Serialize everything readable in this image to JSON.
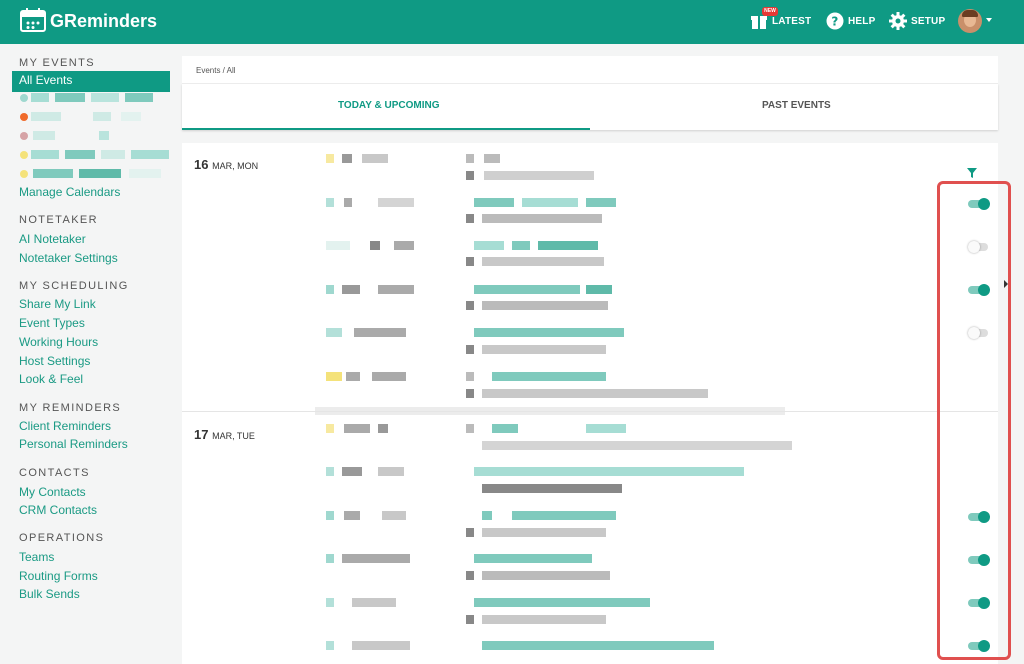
{
  "header": {
    "brand": "GReminders",
    "latest_label": "LATEST",
    "new_badge": "NEW",
    "help_label": "HELP",
    "setup_label": "SETUP"
  },
  "sidebar": {
    "my_events": {
      "title": "MY EVENTS",
      "active": "All Events",
      "manage": "Manage Calendars"
    },
    "notetaker": {
      "title": "NOTETAKER",
      "items": [
        "AI Notetaker",
        "Notetaker Settings"
      ]
    },
    "my_scheduling": {
      "title": "MY SCHEDULING",
      "items": [
        "Share My Link",
        "Event Types",
        "Working Hours",
        "Host Settings",
        "Look & Feel"
      ]
    },
    "my_reminders": {
      "title": "MY REMINDERS",
      "items": [
        "Client Reminders",
        "Personal Reminders"
      ]
    },
    "contacts": {
      "title": "CONTACTS",
      "items": [
        "My Contacts",
        "CRM Contacts"
      ]
    },
    "operations": {
      "title": "OPERATIONS",
      "items": [
        "Teams",
        "Routing Forms",
        "Bulk Sends"
      ]
    }
  },
  "breadcrumb": "Events / All",
  "tabs": {
    "upcoming": "TODAY & UPCOMING",
    "past": "PAST EVENTS"
  },
  "days": [
    {
      "day": "16",
      "label": "MAR, MON"
    },
    {
      "day": "17",
      "label": "MAR, TUE"
    }
  ],
  "toggles": [
    true,
    false,
    true,
    false,
    true,
    true,
    true,
    true
  ],
  "colors": {
    "brand": "#0f9a84",
    "highlight": "#e0504f"
  }
}
